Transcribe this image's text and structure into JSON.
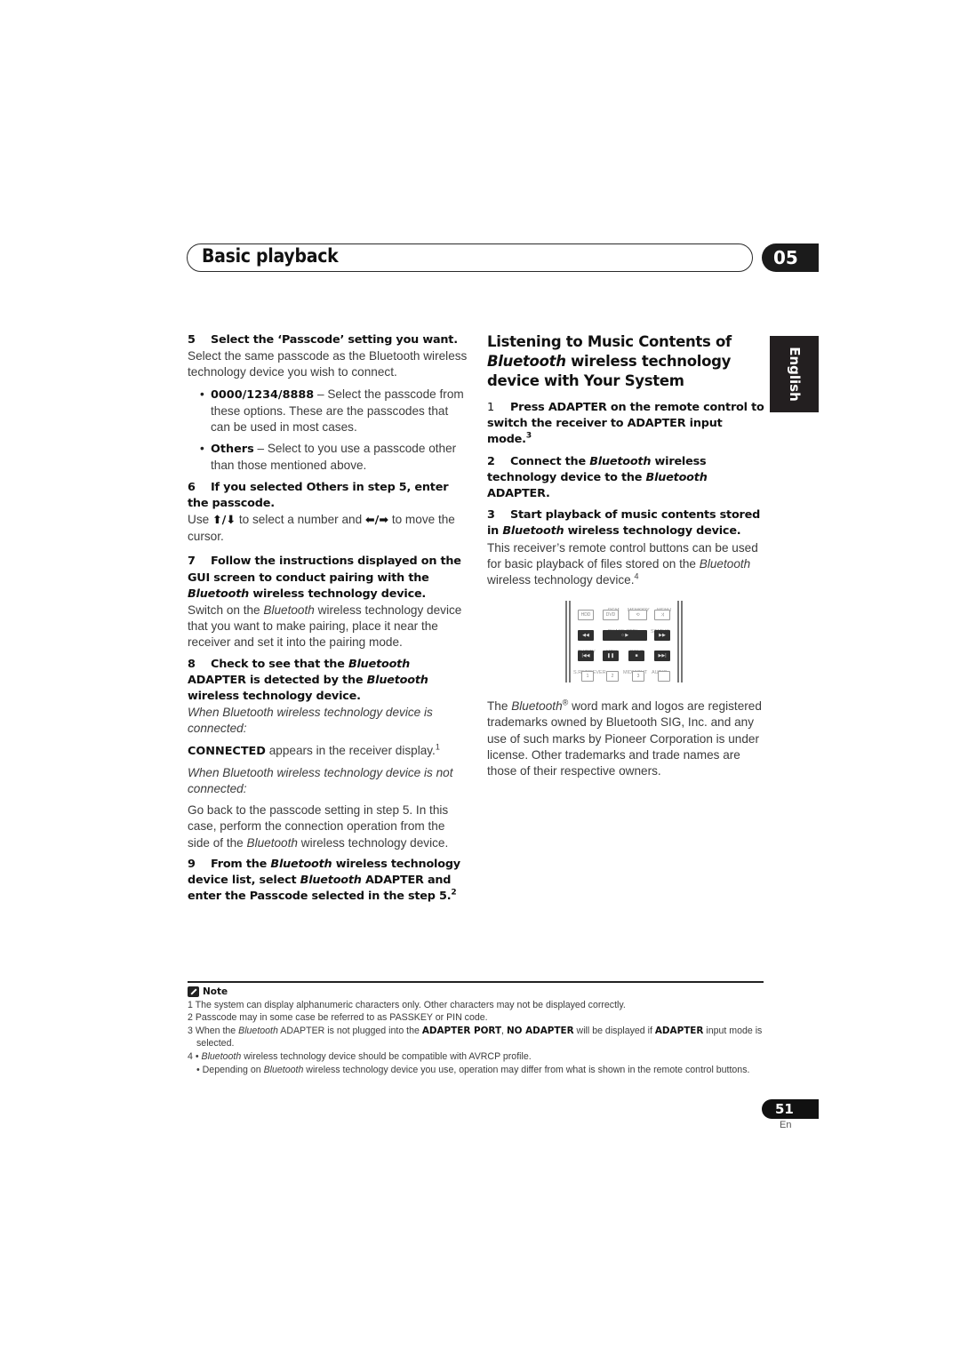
{
  "header": {
    "title": "Basic playback",
    "chapter": "05"
  },
  "language_tab": "English",
  "left_column": {
    "step5": {
      "num": "5",
      "heading": "Select the ‘Passcode’ setting you want.",
      "body": "Select the same passcode as the Bluetooth wireless technology device you wish to connect.",
      "bullets": [
        {
          "term": "0000/1234/8888",
          "text": " – Select the passcode from these options. These are the passcodes that can be used in most cases."
        },
        {
          "term": "Others",
          "text": " – Select to you use a passcode other than those mentioned above."
        }
      ]
    },
    "step6": {
      "num": "6",
      "heading": "If you selected Others in step 5, enter the passcode.",
      "body_pre": "Use ",
      "arrows_ud": "⬆/⬇",
      "body_mid": " to select a number and ",
      "arrows_lr": "⬅/➡",
      "body_post": " to move the cursor."
    },
    "step7": {
      "num": "7",
      "heading_pre": "Follow the instructions displayed on the GUI screen to conduct pairing with the ",
      "heading_it": "Bluetooth",
      "heading_post": " wireless technology device.",
      "body_pre": "Switch on the ",
      "body_it": "Bluetooth",
      "body_post": " wireless technology device that you want to make pairing, place it near the receiver and set it into the pairing mode."
    },
    "step8": {
      "num": "8",
      "heading_a": "Check to see that the ",
      "heading_it1": "Bluetooth",
      "heading_b": " ADAPTER is detected by the ",
      "heading_it2": "Bluetooth",
      "heading_c": " wireless technology device.",
      "connected_label": "When Bluetooth wireless technology device is connected:",
      "connected_term": "CONNECTED",
      "connected_text": " appears in the receiver display.",
      "connected_note": "1",
      "not_connected_label": "When Bluetooth wireless technology device is not connected:",
      "not_connected_pre": "Go back to the passcode setting in step 5. In this case, perform the connection operation from the side of the ",
      "not_connected_it": "Bluetooth",
      "not_connected_post": " wireless technology device."
    },
    "step9": {
      "num": "9",
      "heading_a": "From the ",
      "heading_it1": "Bluetooth",
      "heading_b": " wireless technology device list, select ",
      "heading_it2": "Bluetooth",
      "heading_c": " ADAPTER and enter the Passcode selected in the step 5.",
      "note": "2"
    }
  },
  "right_column": {
    "title_line1": "Listening to Music Contents of",
    "title_it": "Bluetooth",
    "title_line2_post": " wireless technology",
    "title_line3": "device with Your System",
    "step1": {
      "num": "1",
      "heading": "Press ADAPTER on the remote control to switch the receiver to ADAPTER input mode.",
      "note": "3"
    },
    "step2": {
      "num": "2",
      "heading_a": "Connect the ",
      "heading_it1": "Bluetooth",
      "heading_b": " wireless technology device to the ",
      "heading_it2": "Bluetooth",
      "heading_c": " ADAPTER."
    },
    "step3": {
      "num": "3",
      "heading_a": "Start playback of music contents stored in ",
      "heading_it": "Bluetooth",
      "heading_b": " wireless technology device.",
      "body_a": "This receiver’s remote control buttons can be used for basic playback of files stored on the ",
      "body_it": "Bluetooth",
      "body_b": " wireless technology device.",
      "note": "4"
    },
    "remote": {
      "labels": {
        "pgm": "PGM",
        "memory": "MEMORY",
        "menu": "MENU",
        "phase_ctrl": "PHASE CTRL",
        "status": "STATUS",
        "tv_dtv": "TV/DTV",
        "mpx": "MPX",
        "pqls": "PQLS",
        "sretriever": "S.RETRIEVER",
        "midnight": "MIDNIGHT",
        "audio": "AUDIO"
      },
      "buttons": {
        "hdd": "HDD",
        "dvd": "DVD",
        "repeat": "⟲",
        "shuffle": "⤨",
        "rew": "◀◀",
        "play": "○ ▶",
        "ff": "▶▶",
        "prev": "|◀◀",
        "pause": "❚❚",
        "stop": "■",
        "next": "▶▶|",
        "one": "1",
        "two": "2",
        "three": "3",
        "blank": ""
      }
    },
    "trademark_a": "The ",
    "trademark_it": "Bluetooth",
    "trademark_reg": "®",
    "trademark_b": " word mark and logos are registered trademarks owned by Bluetooth SIG, Inc. and any use of such marks by Pioneer Corporation is under license. Other trademarks and trade names are those of their respective owners."
  },
  "notes": {
    "heading": "Note",
    "n1": "1 The system can display alphanumeric characters only. Other characters may not be displayed correctly.",
    "n2": "2 Passcode may in some case be referred to as PASSKEY or PIN code.",
    "n3_a": "3 When the ",
    "n3_it": "Bluetooth",
    "n3_b": " ADAPTER is not plugged into the ",
    "n3_bold1": "ADAPTER PORT",
    "n3_c": ", ",
    "n3_bold2": "NO ADAPTER",
    "n3_d": " will be displayed if ",
    "n3_bold3": "ADAPTER",
    "n3_e": " input mode is selected.",
    "n4_a": "4 • ",
    "n4_it": "Bluetooth",
    "n4_b": " wireless technology device should be compatible with AVRCP profile.",
    "n4_sub_a": "• Depending on ",
    "n4_sub_it": "Bluetooth",
    "n4_sub_b": " wireless technology device you use, operation may differ from what is shown in the remote control buttons."
  },
  "footer": {
    "page_number": "51",
    "lang_code": "En"
  }
}
